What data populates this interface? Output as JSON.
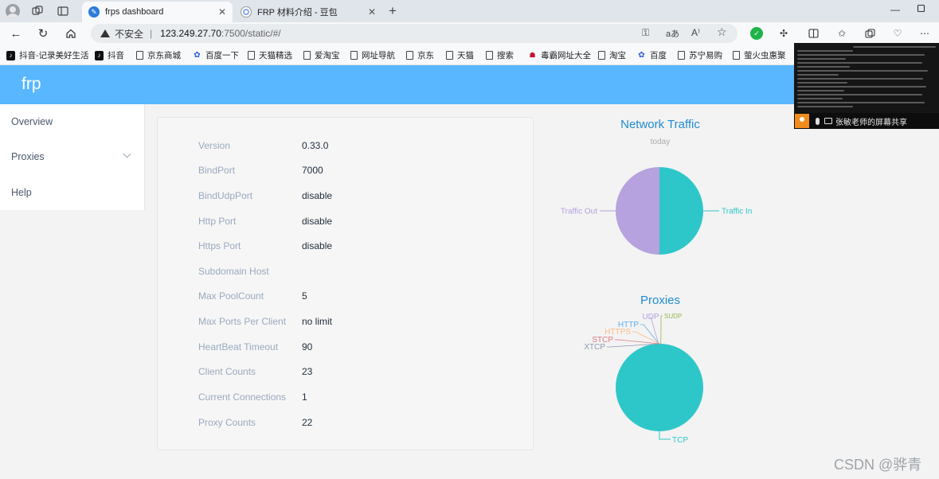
{
  "browser": {
    "tabs": [
      {
        "title": "frps dashboard",
        "active": true,
        "icon": "feather-icon"
      },
      {
        "title": "FRP 材料介绍 - 豆包",
        "active": false,
        "icon": "doubao-icon"
      }
    ],
    "address": {
      "insecure_label": "不安全",
      "separator": "|",
      "host": "123.249.27.70",
      "path": ":7500/static/#/"
    },
    "bookmarks": [
      {
        "label": "抖音-记录美好生活",
        "icon": "tiktok-icon"
      },
      {
        "label": "抖音",
        "icon": "tiktok-icon"
      },
      {
        "label": "京东商城",
        "icon": "page-icon"
      },
      {
        "label": "百度一下",
        "icon": "paw-icon"
      },
      {
        "label": "天猫精选",
        "icon": "page-icon"
      },
      {
        "label": "爱淘宝",
        "icon": "page-icon"
      },
      {
        "label": "网址导航",
        "icon": "page-icon"
      },
      {
        "label": "京东",
        "icon": "page-icon"
      },
      {
        "label": "天猫",
        "icon": "page-icon"
      },
      {
        "label": "搜索",
        "icon": "page-icon"
      },
      {
        "label": "毒霸网址大全",
        "icon": "page-icon"
      },
      {
        "label": "淘宝",
        "icon": "page-icon"
      },
      {
        "label": "百度",
        "icon": "paw-icon"
      },
      {
        "label": "苏宁易购",
        "icon": "page-icon"
      },
      {
        "label": "萤火虫惠聚",
        "icon": "page-icon"
      }
    ]
  },
  "app": {
    "brand": "frp",
    "sidebar": [
      {
        "label": "Overview"
      },
      {
        "label": "Proxies"
      },
      {
        "label": "Help"
      }
    ],
    "info": [
      {
        "label": "Version",
        "value": "0.33.0"
      },
      {
        "label": "BindPort",
        "value": "7000"
      },
      {
        "label": "BindUdpPort",
        "value": "disable"
      },
      {
        "label": "Http Port",
        "value": "disable"
      },
      {
        "label": "Https Port",
        "value": "disable"
      },
      {
        "label": "Subdomain Host",
        "value": ""
      },
      {
        "label": "Max PoolCount",
        "value": "5"
      },
      {
        "label": "Max Ports Per Client",
        "value": "no limit"
      },
      {
        "label": "HeartBeat Timeout",
        "value": "90"
      },
      {
        "label": "Client Counts",
        "value": "23"
      },
      {
        "label": "Current Connections",
        "value": "1"
      },
      {
        "label": "Proxy Counts",
        "value": "22"
      }
    ]
  },
  "chart_data": [
    {
      "type": "pie",
      "title": "Network Traffic",
      "subtitle": "today",
      "categories": [
        "Traffic In",
        "Traffic Out"
      ],
      "values": [
        50,
        50
      ],
      "colors": [
        "#2ec7c9",
        "#b6a2de"
      ]
    },
    {
      "type": "pie",
      "title": "Proxies",
      "categories": [
        "TCP",
        "UDP",
        "HTTP",
        "HTTPS",
        "STCP",
        "XTCP",
        "SUDP"
      ],
      "values": [
        22,
        0,
        0,
        0,
        0,
        0,
        0
      ],
      "colors": [
        "#2ec7c9",
        "#b6a2de",
        "#5ab1ef",
        "#ffb980",
        "#d87a80",
        "#8d98b3",
        "#97b552"
      ]
    }
  ],
  "overlay": {
    "share_label": "张敏老师的屏幕共享"
  },
  "watermark": "CSDN @骅青"
}
